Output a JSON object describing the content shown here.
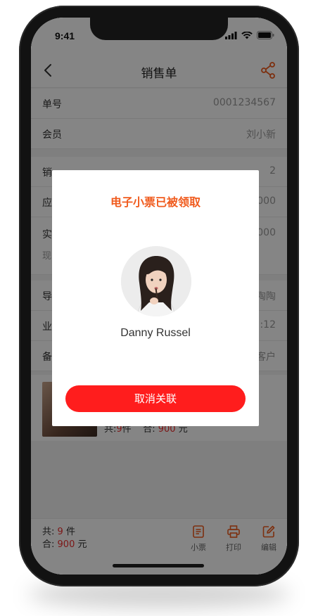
{
  "status": {
    "time": "9:41"
  },
  "nav": {
    "title": "销售单"
  },
  "rows": [
    {
      "label": "单号",
      "value": "0001234567"
    },
    {
      "label": "会员",
      "value": "刘小新"
    },
    {
      "label": "销",
      "value": "2"
    },
    {
      "label": "应",
      "value": "000"
    },
    {
      "label": "实",
      "value": "000",
      "sub": "现"
    },
    {
      "label": "导",
      "value": "陶陶"
    },
    {
      "label": "业",
      "value": "2:12"
    },
    {
      "label": "备",
      "value": "客户"
    }
  ],
  "product": {
    "count_prefix": "共:",
    "count": "9",
    "count_unit": "件",
    "total_prefix": "合:",
    "total": "900",
    "total_unit": "元"
  },
  "bottom": {
    "count_prefix": "共:",
    "count": "9",
    "count_unit": "件",
    "total_prefix": "合:",
    "total": "900",
    "total_unit": "元",
    "buttons": [
      "小票",
      "打印",
      "编辑"
    ]
  },
  "modal": {
    "title": "电子小票已被领取",
    "name": "Danny Russel",
    "button": "取消关联"
  },
  "colors": {
    "accent": "#f05a1c",
    "primary_red": "#ff1d1d",
    "value_red": "#ee2d2d"
  },
  "icons": [
    "back-icon",
    "share-icon",
    "receipt-icon",
    "printer-icon",
    "edit-icon",
    "signal-icon",
    "wifi-icon",
    "battery-icon"
  ]
}
